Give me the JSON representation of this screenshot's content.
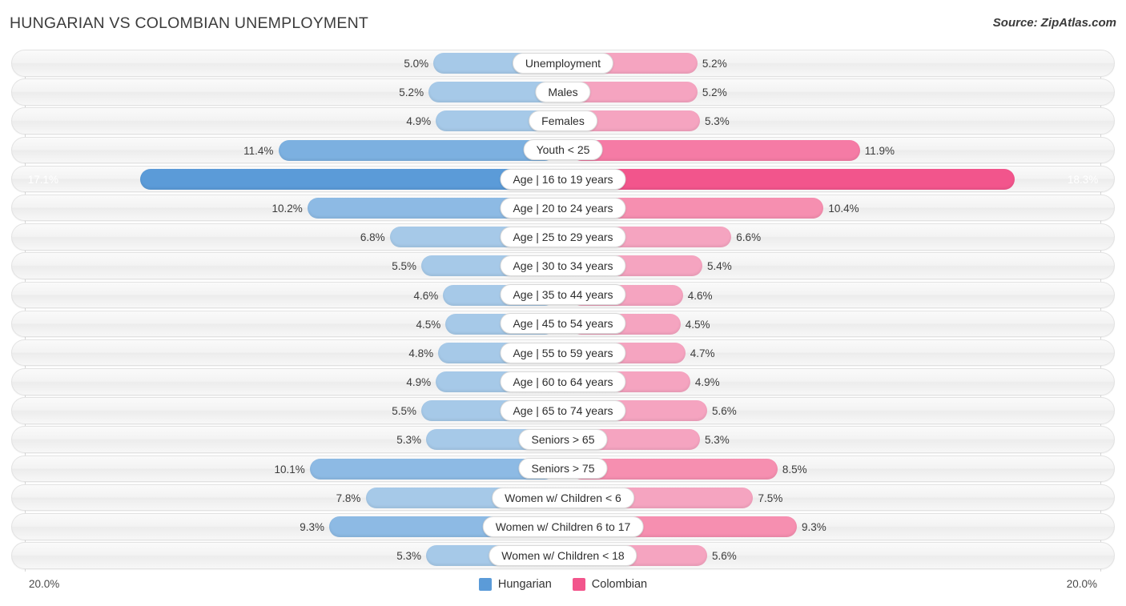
{
  "header": {
    "title": "HUNGARIAN VS COLOMBIAN UNEMPLOYMENT",
    "source": "Source: ZipAtlas.com"
  },
  "axis": {
    "left_label": "20.0%",
    "right_label": "20.0%",
    "max": 20.0
  },
  "legend": {
    "items": [
      {
        "label": "Hungarian",
        "color": "#5b9bd8"
      },
      {
        "label": "Colombian",
        "color": "#f2558c"
      }
    ]
  },
  "chart_data": {
    "type": "bar",
    "title": "HUNGARIAN VS COLOMBIAN UNEMPLOYMENT",
    "subtitle": "Source: ZipAtlas.com",
    "orientation": "horizontal-diverging",
    "xlabel": "",
    "ylabel": "",
    "xlim": [
      20.0,
      20.0
    ],
    "grid": false,
    "legend_position": "bottom-center",
    "categories": [
      "Unemployment",
      "Males",
      "Females",
      "Youth < 25",
      "Age | 16 to 19 years",
      "Age | 20 to 24 years",
      "Age | 25 to 29 years",
      "Age | 30 to 34 years",
      "Age | 35 to 44 years",
      "Age | 45 to 54 years",
      "Age | 55 to 59 years",
      "Age | 60 to 64 years",
      "Age | 65 to 74 years",
      "Seniors > 65",
      "Seniors > 75",
      "Women w/ Children < 6",
      "Women w/ Children 6 to 17",
      "Women w/ Children < 18"
    ],
    "series": [
      {
        "name": "Hungarian",
        "color": "#5b9bd8",
        "values": [
          5.0,
          5.2,
          4.9,
          11.4,
          17.1,
          10.2,
          6.8,
          5.5,
          4.6,
          4.5,
          4.8,
          4.9,
          5.5,
          5.3,
          10.1,
          7.8,
          9.3,
          5.3
        ]
      },
      {
        "name": "Colombian",
        "color": "#f2558c",
        "values": [
          5.2,
          5.2,
          5.3,
          11.9,
          18.3,
          10.4,
          6.6,
          5.4,
          4.6,
          4.5,
          4.7,
          4.9,
          5.6,
          5.3,
          8.5,
          7.5,
          9.3,
          5.6
        ]
      }
    ]
  },
  "rows": [
    {
      "label": "Unemployment",
      "left": "5.0%",
      "right": "5.2%",
      "lv": 5.0,
      "rv": 5.2,
      "tone": "light"
    },
    {
      "label": "Males",
      "left": "5.2%",
      "right": "5.2%",
      "lv": 5.2,
      "rv": 5.2,
      "tone": "light"
    },
    {
      "label": "Females",
      "left": "4.9%",
      "right": "5.3%",
      "lv": 4.9,
      "rv": 5.3,
      "tone": "light"
    },
    {
      "label": "Youth < 25",
      "left": "11.4%",
      "right": "11.9%",
      "lv": 11.4,
      "rv": 11.9,
      "tone": "mid"
    },
    {
      "label": "Age | 16 to 19 years",
      "left": "17.1%",
      "right": "18.3%",
      "lv": 17.1,
      "rv": 18.3,
      "tone": "hl"
    },
    {
      "label": "Age | 20 to 24 years",
      "left": "10.2%",
      "right": "10.4%",
      "lv": 10.2,
      "rv": 10.4,
      "tone": "mid2"
    },
    {
      "label": "Age | 25 to 29 years",
      "left": "6.8%",
      "right": "6.6%",
      "lv": 6.8,
      "rv": 6.6,
      "tone": "light"
    },
    {
      "label": "Age | 30 to 34 years",
      "left": "5.5%",
      "right": "5.4%",
      "lv": 5.5,
      "rv": 5.4,
      "tone": "light"
    },
    {
      "label": "Age | 35 to 44 years",
      "left": "4.6%",
      "right": "4.6%",
      "lv": 4.6,
      "rv": 4.6,
      "tone": "light"
    },
    {
      "label": "Age | 45 to 54 years",
      "left": "4.5%",
      "right": "4.5%",
      "lv": 4.5,
      "rv": 4.5,
      "tone": "light"
    },
    {
      "label": "Age | 55 to 59 years",
      "left": "4.8%",
      "right": "4.7%",
      "lv": 4.8,
      "rv": 4.7,
      "tone": "light"
    },
    {
      "label": "Age | 60 to 64 years",
      "left": "4.9%",
      "right": "4.9%",
      "lv": 4.9,
      "rv": 4.9,
      "tone": "light"
    },
    {
      "label": "Age | 65 to 74 years",
      "left": "5.5%",
      "right": "5.6%",
      "lv": 5.5,
      "rv": 5.6,
      "tone": "light"
    },
    {
      "label": "Seniors > 65",
      "left": "5.3%",
      "right": "5.3%",
      "lv": 5.3,
      "rv": 5.3,
      "tone": "light"
    },
    {
      "label": "Seniors > 75",
      "left": "10.1%",
      "right": "8.5%",
      "lv": 10.1,
      "rv": 8.5,
      "tone": "mid2"
    },
    {
      "label": "Women w/ Children < 6",
      "left": "7.8%",
      "right": "7.5%",
      "lv": 7.8,
      "rv": 7.5,
      "tone": "light"
    },
    {
      "label": "Women w/ Children 6 to 17",
      "left": "9.3%",
      "right": "9.3%",
      "lv": 9.3,
      "rv": 9.3,
      "tone": "mid2"
    },
    {
      "label": "Women w/ Children < 18",
      "left": "5.3%",
      "right": "5.6%",
      "lv": 5.3,
      "rv": 5.6,
      "tone": "light"
    }
  ]
}
